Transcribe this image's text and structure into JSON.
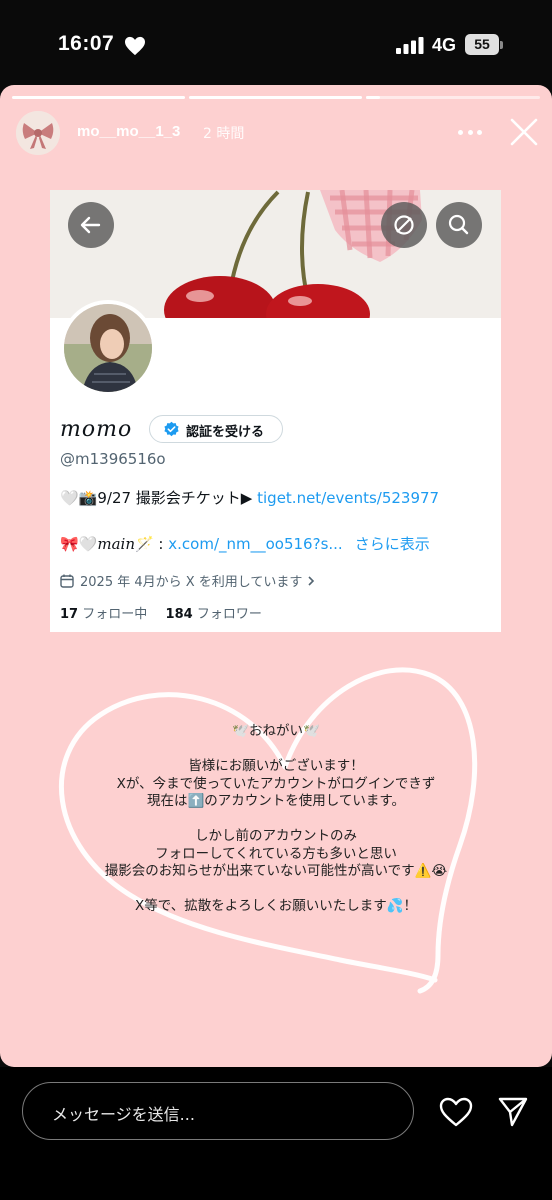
{
  "status_bar": {
    "time": "16:07",
    "network": "4G",
    "battery": "55"
  },
  "story": {
    "progress_segments": 3,
    "progress_active_index": 2,
    "username": "mo__mo__1_3",
    "posted_time": "2 時間",
    "background_color": "#fdd0d0"
  },
  "profile_card": {
    "display_name": "momo",
    "verify_label": "認証を受ける",
    "handle": "@m1396516o",
    "bio_line1_text": "🤍📸9/27 撮影会チケット▶ ",
    "bio_line1_link": "tiget.net/events/523977",
    "bio_line2_emoji": "🎀🤍",
    "bio_line2_main": "main",
    "bio_line2_sep": "🪄 : ",
    "bio_line2_link": "x.com/_nm__oo516?s...",
    "show_more": "さらに表示",
    "joined": "2025 年 4月から X を利用しています",
    "following_count": "17",
    "following_label": "フォロー中",
    "followers_count": "184",
    "followers_label": "フォロワー"
  },
  "message": {
    "lines": [
      "🕊️おねがい🕊️",
      "",
      "皆様にお願いがございます！",
      "Xが、今まで使っていたアカウントがログインできず",
      "現在は⬆️のアカウントを使用しています。",
      "",
      "しかし前のアカウントのみ",
      "フォローしてくれている方も多いと思い",
      "撮影会のお知らせが出来ていない可能性が高いです⚠️😭",
      "",
      "X等で、拡散をよろしくお願いいたします💦！"
    ]
  },
  "bottom_bar": {
    "message_placeholder": "メッセージを送信..."
  },
  "icons": {
    "status_heart": "heart-icon",
    "signal": "signal-bars-icon",
    "more": "more-horizontal-icon",
    "close": "close-icon",
    "back": "back-arrow-icon",
    "circle_slash": "circle-slash-icon",
    "search": "search-icon",
    "verified": "verified-badge-icon",
    "calendar": "calendar-icon",
    "like": "heart-outline-icon",
    "send": "send-paper-plane-icon"
  },
  "colors": {
    "link": "#1d9bf0",
    "verified": "#1d9bf0"
  }
}
